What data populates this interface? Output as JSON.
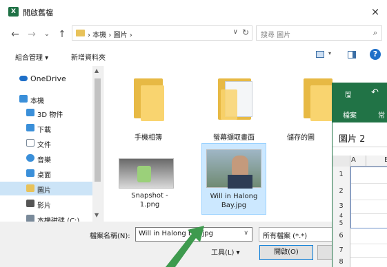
{
  "dialog": {
    "title": "開啟舊檔",
    "app_icon_letter": "X",
    "close_label": "×"
  },
  "nav": {
    "back": "←",
    "forward": "→",
    "recent": "⌄",
    "up": "↑"
  },
  "address": {
    "path": "›  本機  ›  圖片  ›",
    "chevron": "∨",
    "refresh": "↻"
  },
  "search": {
    "placeholder": "搜尋 圖片"
  },
  "toolbar": {
    "organize": "組合管理 ▾",
    "new_folder": "新增資料夾",
    "view_arrow": "▾",
    "help": "?"
  },
  "sidebar": {
    "items": [
      {
        "label": "OneDrive",
        "icon": "cloud-icon",
        "color": "#1e6fc8"
      },
      {
        "label": "本機",
        "icon": "computer-icon",
        "color": "#3a8fd9"
      },
      {
        "label": "3D 物件",
        "icon": "cube-icon",
        "color": "#3a8fd9"
      },
      {
        "label": "下載",
        "icon": "download-icon",
        "color": "#3a8fd9"
      },
      {
        "label": "文件",
        "icon": "document-icon",
        "color": "#7a8a9a"
      },
      {
        "label": "音樂",
        "icon": "music-icon",
        "color": "#3a8fd9"
      },
      {
        "label": "桌面",
        "icon": "desktop-icon",
        "color": "#3a8fd9"
      },
      {
        "label": "圖片",
        "icon": "pictures-icon",
        "color": "#e8c25a"
      },
      {
        "label": "影片",
        "icon": "video-icon",
        "color": "#555555"
      },
      {
        "label": "本機磁碟 (C:)",
        "icon": "drive-icon",
        "color": "#7a8a9a"
      }
    ],
    "selected_index": 7
  },
  "files": [
    {
      "name": "手機相簿",
      "type": "folder"
    },
    {
      "name": "螢幕擷取畫面",
      "type": "folder"
    },
    {
      "name": "儲存的圖",
      "type": "folder"
    },
    {
      "name": "Snapshot -\n1.png",
      "type": "image"
    },
    {
      "name": "Will in Halong\nBay.jpg",
      "type": "image",
      "selected": true
    }
  ],
  "footer": {
    "filename_label": "檔案名稱(N):",
    "filename_value": "Will in Halong Bay.jpg",
    "filename_chevron": "∨",
    "filetype_value": "所有檔案 (*.*)",
    "tools_label": "工具(L)  ▾",
    "open_label": "開啟(O)"
  },
  "excel": {
    "save_icon": "🖫",
    "undo_icon": "↶",
    "tab_file": "檔案",
    "tab_home": "常",
    "name_box": "圖片 2",
    "col_a": "A",
    "col_b": "B",
    "rows": [
      "1",
      "2",
      "3",
      "4",
      "5",
      "6",
      "7",
      "8"
    ]
  },
  "colors": {
    "excel_green": "#217346",
    "selection": "#cce4f7",
    "folder": "#f9d46f",
    "arrow": "#3e9a4e"
  }
}
